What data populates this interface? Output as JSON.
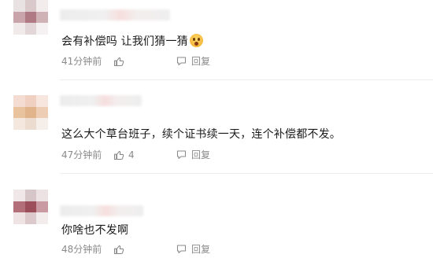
{
  "comments": [
    {
      "text": "会有补偿吗 让我们猜一猜",
      "emoji": "shocked-face-emoji",
      "time": "41分钟前",
      "like_count": "",
      "reply_label": "回复",
      "avatar_colors": [
        "#e9e2e3",
        "#d9c9cb",
        "#f2eced",
        "#c9a5ab",
        "#b07a84",
        "#cfb2b6",
        "#f0eaeb",
        "#e2d6d8",
        "#f5f0f1"
      ]
    },
    {
      "text": "这么大个草台班子，续个证书续一天，连个补偿都不发。",
      "emoji": "",
      "time": "47分钟前",
      "like_count": "4",
      "reply_label": "回复",
      "avatar_colors": [
        "#f4dcd2",
        "#f0d0c0",
        "#f7e6de",
        "#e9c29e",
        "#e2b48c",
        "#edcdb4",
        "#f3e7de",
        "#ecdcd0",
        "#f6eee8"
      ]
    },
    {
      "text": "你啥也不发啊",
      "emoji": "",
      "time": "48分钟前",
      "like_count": "",
      "reply_label": "回复",
      "avatar_colors": [
        "#efe7e8",
        "#d7c6c8",
        "#ece2e3",
        "#b26f79",
        "#9c4e5a",
        "#c99aa1",
        "#efe3e4",
        "#dcc9cb",
        "#f3ecec"
      ]
    }
  ]
}
